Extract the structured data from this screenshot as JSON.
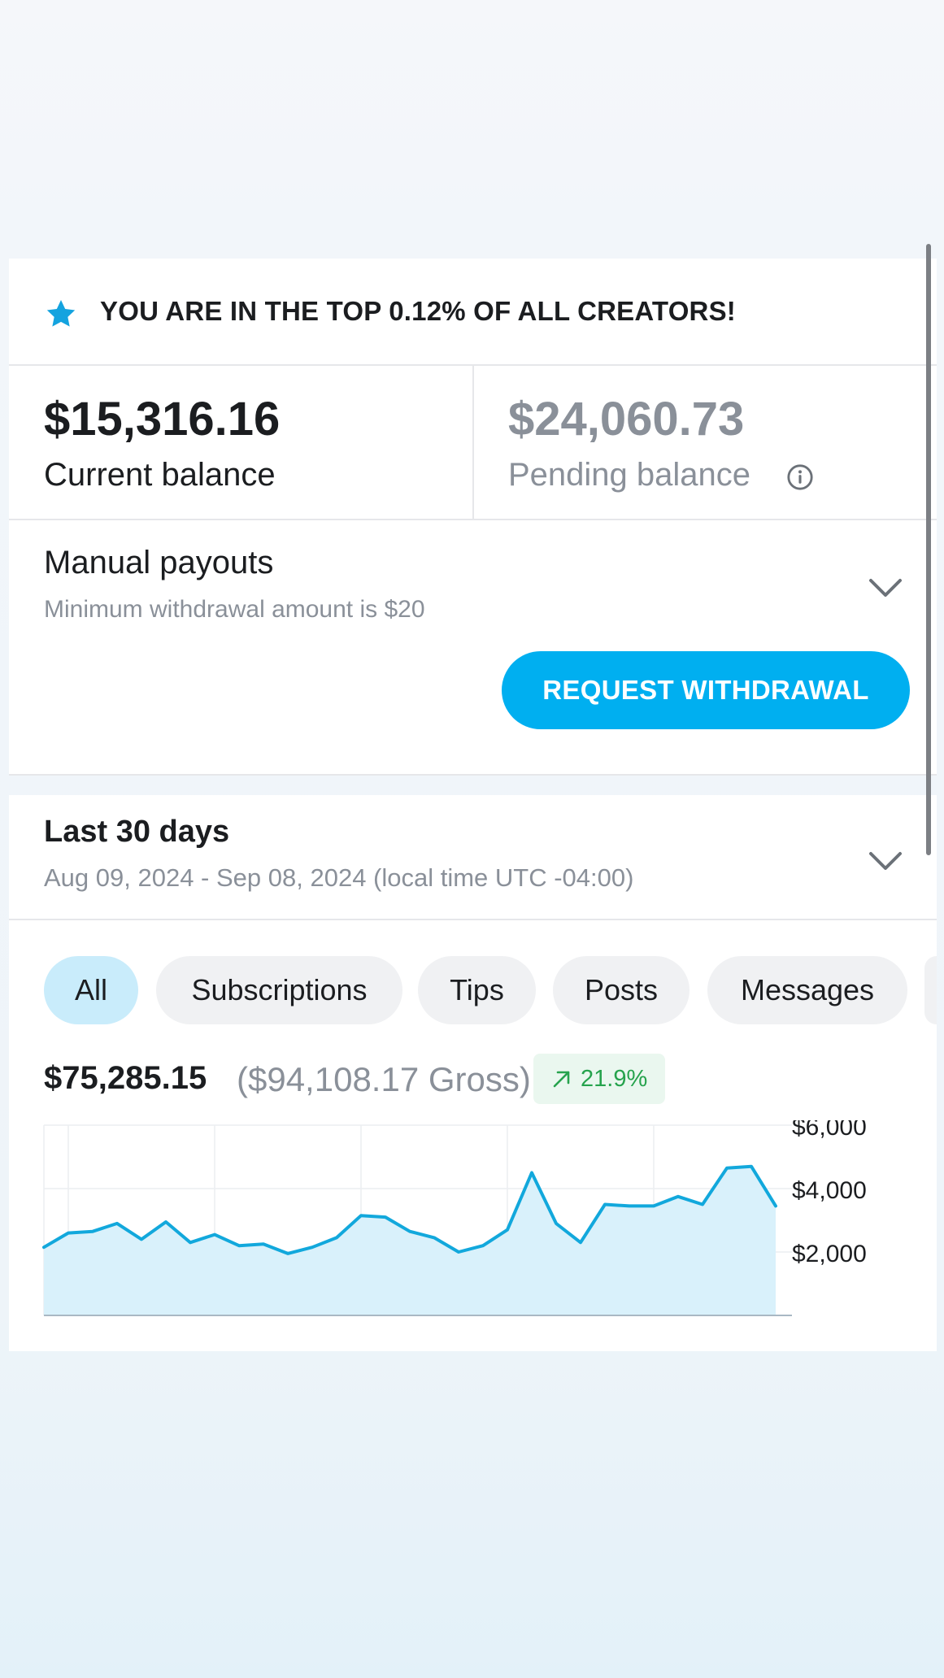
{
  "banner": {
    "text": "YOU ARE IN THE TOP 0.12% OF ALL CREATORS!",
    "icon": "star-icon"
  },
  "balances": {
    "current": {
      "amount": "$15,316.16",
      "label": "Current balance"
    },
    "pending": {
      "amount": "$24,060.73",
      "label": "Pending balance",
      "icon": "info-icon"
    }
  },
  "payouts": {
    "title": "Manual payouts",
    "subtitle": "Minimum withdrawal amount is $20",
    "button_label": "REQUEST WITHDRAWAL"
  },
  "period": {
    "title": "Last 30 days",
    "range": "Aug 09, 2024 - Sep 08, 2024 (local time UTC -04:00)"
  },
  "filters": [
    "All",
    "Subscriptions",
    "Tips",
    "Posts",
    "Messages"
  ],
  "active_filter": "All",
  "totals": {
    "net": "$75,285.15",
    "gross": "($94,108.17 Gross)",
    "change": "21.9%",
    "change_direction": "up"
  },
  "colors": {
    "accent": "#00aff0",
    "line": "#12a8dc",
    "area": "#d9f1fb",
    "positive": "#26a34d"
  },
  "chart_data": {
    "type": "area",
    "x": [
      1,
      2,
      3,
      4,
      5,
      6,
      7,
      8,
      9,
      10,
      11,
      12,
      13,
      14,
      15,
      16,
      17,
      18,
      19,
      20,
      21,
      22,
      23,
      24,
      25,
      26,
      27,
      28,
      29,
      30,
      31
    ],
    "values": [
      2150,
      2600,
      2650,
      2900,
      2400,
      2950,
      2300,
      2550,
      2200,
      2250,
      1950,
      2150,
      2450,
      3150,
      3100,
      2650,
      2450,
      2000,
      2200,
      2700,
      4500,
      2900,
      2300,
      3500,
      3450,
      3450,
      3750,
      3500,
      4650,
      4700,
      3450
    ],
    "y_ticks": [
      "$6,000",
      "$4,000",
      "$2,000"
    ],
    "ylim": [
      0,
      6000
    ],
    "grid": true
  }
}
